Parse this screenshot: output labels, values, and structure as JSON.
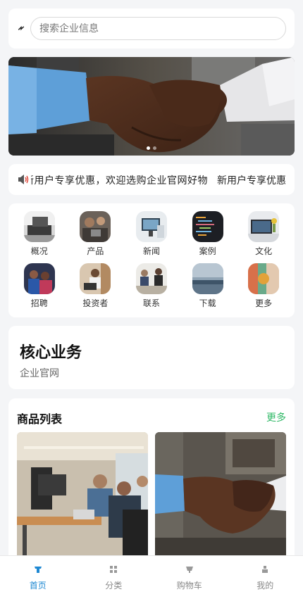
{
  "search": {
    "placeholder": "搜索企业信息"
  },
  "banner": {
    "slide_count": 2,
    "active_slide": 1
  },
  "notice": {
    "marquee_text": "新用户专享优惠，欢迎选购企业官网好物!",
    "promo_text": "新用户专享优惠"
  },
  "grid": {
    "items": [
      {
        "label": "概况"
      },
      {
        "label": "产品"
      },
      {
        "label": "新闻"
      },
      {
        "label": "案例"
      },
      {
        "label": "文化"
      },
      {
        "label": "招聘"
      },
      {
        "label": "投资者"
      },
      {
        "label": "联系"
      },
      {
        "label": "下载"
      },
      {
        "label": "更多"
      }
    ]
  },
  "core": {
    "title": "核心业务",
    "subtitle": "企业官网"
  },
  "products": {
    "title": "商品列表",
    "more_label": "更多"
  },
  "tabbar": {
    "active_index": 0,
    "tabs": [
      {
        "label": "首页"
      },
      {
        "label": "分类"
      },
      {
        "label": "购物车"
      },
      {
        "label": "我的"
      }
    ]
  },
  "colors": {
    "accent": "#1e88d2",
    "more": "#2fb866"
  }
}
